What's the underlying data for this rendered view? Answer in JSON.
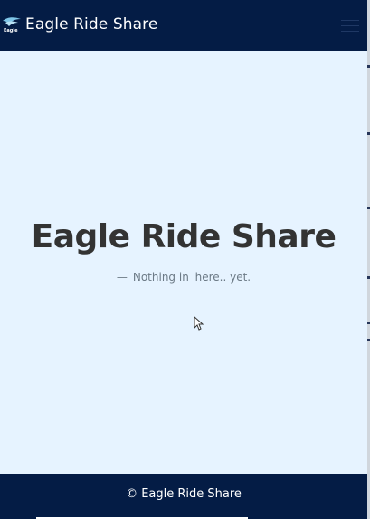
{
  "navbar": {
    "logo_text": "Eagle",
    "brand": "Eagle Ride Share",
    "menu_icon": "hamburger-menu-icon"
  },
  "hero": {
    "title": "Eagle Ride Share",
    "subtitle_dash": "—",
    "subtitle_part1": "Nothing in ",
    "subtitle_part2": "here.. yet."
  },
  "footer": {
    "copyright": "© Eagle Ride Share"
  },
  "colors": {
    "navbar_bg": "#041c45",
    "main_bg": "#e6f3ff",
    "title_color": "#333333",
    "subtitle_color": "#6c7a86"
  }
}
